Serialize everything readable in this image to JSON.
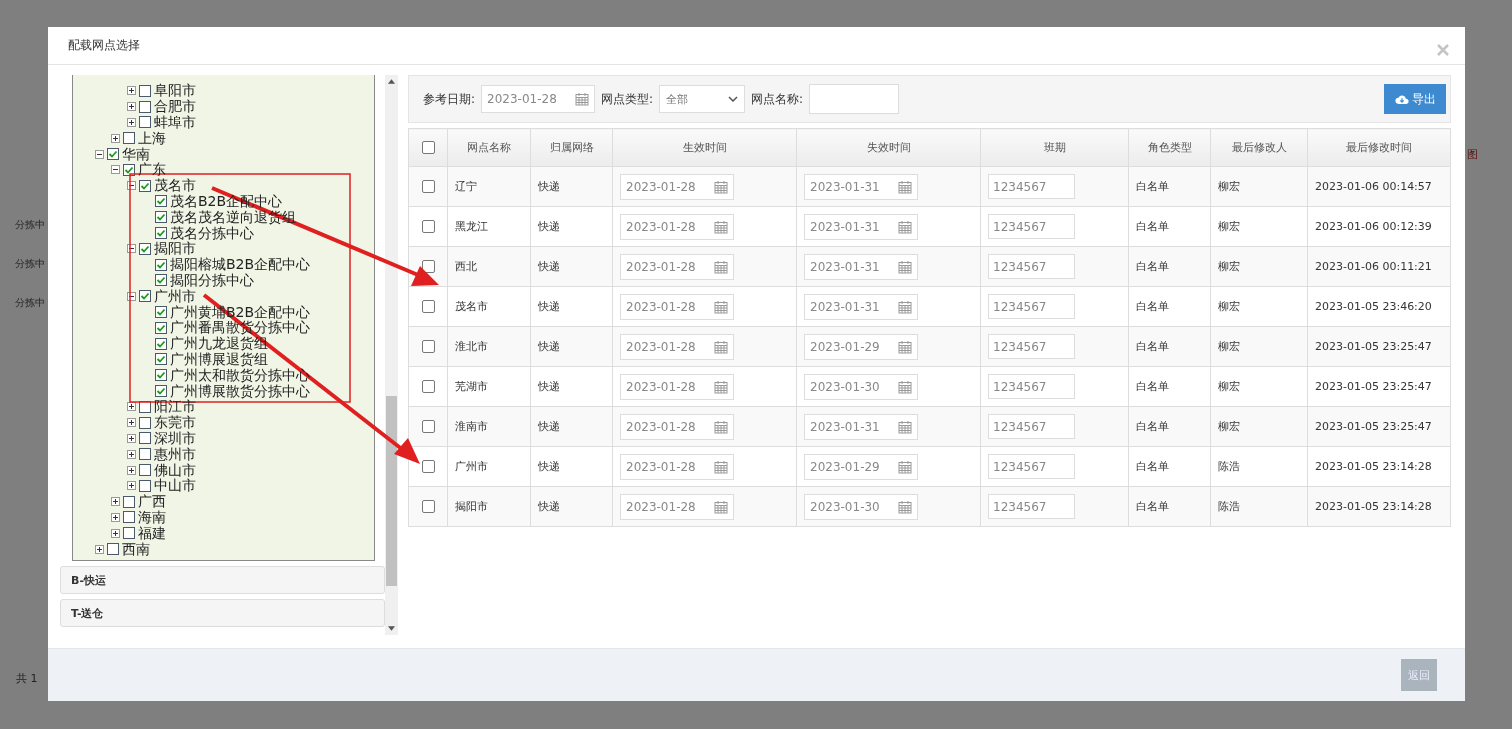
{
  "backdrop": {
    "row_labels": [
      "分拣中",
      "分拣中",
      "分拣中"
    ],
    "pager": "共 1",
    "side_mark": "图"
  },
  "dialog": {
    "title": "配载网点选择",
    "tree": {
      "items": [
        {
          "children": [
            {
              "children": [
                {
                  "kind": "group",
                  "label": "阜阳市",
                  "checked": false,
                  "expanded": false
                },
                {
                  "kind": "group",
                  "label": "合肥市",
                  "checked": false,
                  "expanded": false
                },
                {
                  "kind": "group",
                  "label": "蚌埠市",
                  "checked": false,
                  "expanded": false
                }
              ]
            },
            {
              "kind": "group",
              "label": "上海",
              "checked": false,
              "expanded": false
            }
          ]
        },
        {
          "kind": "group",
          "label": "华南",
          "checked": true,
          "expanded": true,
          "children": [
            {
              "kind": "group",
              "label": "广东",
              "checked": true,
              "expanded": true,
              "children": [
                {
                  "kind": "group",
                  "label": "茂名市",
                  "checked": true,
                  "expanded": true,
                  "children": [
                    {
                      "kind": "leaf",
                      "label": "茂名B2B企配中心",
                      "checked": true
                    },
                    {
                      "kind": "leaf",
                      "label": "茂名茂名逆向退货组",
                      "checked": true
                    },
                    {
                      "kind": "leaf",
                      "label": "茂名分拣中心",
                      "checked": true
                    }
                  ]
                },
                {
                  "kind": "group",
                  "label": "揭阳市",
                  "checked": true,
                  "expanded": true,
                  "children": [
                    {
                      "kind": "leaf",
                      "label": "揭阳榕城B2B企配中心",
                      "checked": true
                    },
                    {
                      "kind": "leaf",
                      "label": "揭阳分拣中心",
                      "checked": true
                    }
                  ]
                },
                {
                  "kind": "group",
                  "label": "广州市",
                  "checked": true,
                  "expanded": true,
                  "children": [
                    {
                      "kind": "leaf",
                      "label": "广州黄埔B2B企配中心",
                      "checked": true
                    },
                    {
                      "kind": "leaf",
                      "label": "广州番禺散货分拣中心",
                      "checked": true
                    },
                    {
                      "kind": "leaf",
                      "label": "广州九龙退货组",
                      "checked": true
                    },
                    {
                      "kind": "leaf",
                      "label": "广州博展退货组",
                      "checked": true
                    },
                    {
                      "kind": "leaf",
                      "label": "广州太和散货分拣中心",
                      "checked": true
                    },
                    {
                      "kind": "leaf",
                      "label": "广州博展散货分拣中心",
                      "checked": true
                    }
                  ]
                },
                {
                  "kind": "group",
                  "label": "阳江市",
                  "checked": false,
                  "expanded": false
                },
                {
                  "kind": "group",
                  "label": "东莞市",
                  "checked": false,
                  "expanded": false
                },
                {
                  "kind": "group",
                  "label": "深圳市",
                  "checked": false,
                  "expanded": false
                },
                {
                  "kind": "group",
                  "label": "惠州市",
                  "checked": false,
                  "expanded": false
                },
                {
                  "kind": "group",
                  "label": "佛山市",
                  "checked": false,
                  "expanded": false
                },
                {
                  "kind": "group",
                  "label": "中山市",
                  "checked": false,
                  "expanded": false
                }
              ]
            },
            {
              "kind": "group",
              "label": "广西",
              "checked": false,
              "expanded": false
            },
            {
              "kind": "group",
              "label": "海南",
              "checked": false,
              "expanded": false
            },
            {
              "kind": "group",
              "label": "福建",
              "checked": false,
              "expanded": false
            }
          ]
        },
        {
          "kind": "group",
          "label": "西南",
          "checked": false,
          "expanded": false
        }
      ]
    },
    "sections": [
      "B-快运",
      "T-送仓"
    ],
    "filters": {
      "date_label": "参考日期:",
      "date_value": "2023-01-28",
      "type_label": "网点类型:",
      "type_value": "全部",
      "name_label": "网点名称:"
    },
    "export_button": "导出",
    "table": {
      "all_selected": false,
      "columns": [
        "网点名称",
        "归属网络",
        "生效时间",
        "失效时间",
        "班期",
        "角色类型",
        "最后修改人",
        "最后修改时间"
      ],
      "rows": [
        {
          "selected": false,
          "name": "辽宁",
          "network": "快递",
          "start": "2023-01-28",
          "end": "2023-01-31",
          "period": "1234567",
          "role": "白名单",
          "modifier": "柳宏",
          "modified": "2023-01-06 00:14:57"
        },
        {
          "selected": false,
          "name": "黑龙江",
          "network": "快递",
          "start": "2023-01-28",
          "end": "2023-01-31",
          "period": "1234567",
          "role": "白名单",
          "modifier": "柳宏",
          "modified": "2023-01-06 00:12:39"
        },
        {
          "selected": false,
          "name": "西北",
          "network": "快递",
          "start": "2023-01-28",
          "end": "2023-01-31",
          "period": "1234567",
          "role": "白名单",
          "modifier": "柳宏",
          "modified": "2023-01-06 00:11:21"
        },
        {
          "selected": false,
          "name": "茂名市",
          "network": "快递",
          "start": "2023-01-28",
          "end": "2023-01-31",
          "period": "1234567",
          "role": "白名单",
          "modifier": "柳宏",
          "modified": "2023-01-05 23:46:20"
        },
        {
          "selected": false,
          "name": "淮北市",
          "network": "快递",
          "start": "2023-01-28",
          "end": "2023-01-29",
          "period": "1234567",
          "role": "白名单",
          "modifier": "柳宏",
          "modified": "2023-01-05 23:25:47"
        },
        {
          "selected": false,
          "name": "芜湖市",
          "network": "快递",
          "start": "2023-01-28",
          "end": "2023-01-30",
          "period": "1234567",
          "role": "白名单",
          "modifier": "柳宏",
          "modified": "2023-01-05 23:25:47"
        },
        {
          "selected": false,
          "name": "淮南市",
          "network": "快递",
          "start": "2023-01-28",
          "end": "2023-01-31",
          "period": "1234567",
          "role": "白名单",
          "modifier": "柳宏",
          "modified": "2023-01-05 23:25:47"
        },
        {
          "selected": false,
          "name": "广州市",
          "network": "快递",
          "start": "2023-01-28",
          "end": "2023-01-29",
          "period": "1234567",
          "role": "白名单",
          "modifier": "陈浩",
          "modified": "2023-01-05 23:14:28"
        },
        {
          "selected": false,
          "name": "揭阳市",
          "network": "快递",
          "start": "2023-01-28",
          "end": "2023-01-30",
          "period": "1234567",
          "role": "白名单",
          "modifier": "陈浩",
          "modified": "2023-01-05 23:14:28"
        }
      ]
    },
    "back_button": {
      "label": "返回",
      "disabled": true
    }
  }
}
